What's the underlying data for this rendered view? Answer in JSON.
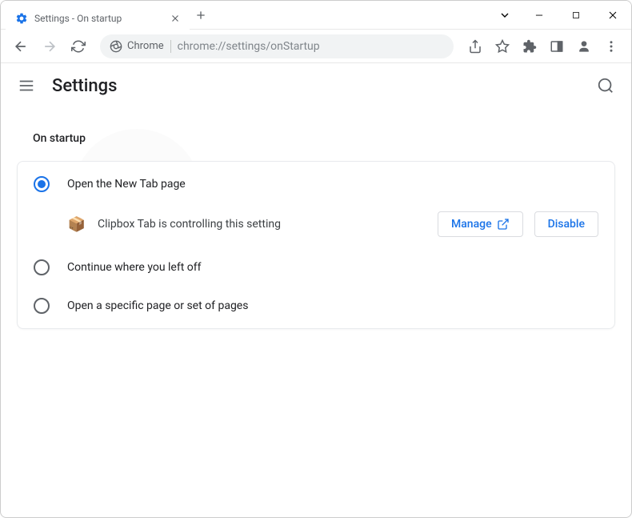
{
  "tab": {
    "title": "Settings - On startup"
  },
  "url": {
    "prefix": "Chrome",
    "path": "chrome://settings/onStartup"
  },
  "page": {
    "title": "Settings",
    "section": "On startup"
  },
  "options": {
    "newtab": "Open the New Tab page",
    "continue": "Continue where you left off",
    "specific": "Open a specific page or set of pages"
  },
  "extension": {
    "message": "Clipbox Tab is controlling this setting",
    "manage": "Manage",
    "disable": "Disable"
  }
}
